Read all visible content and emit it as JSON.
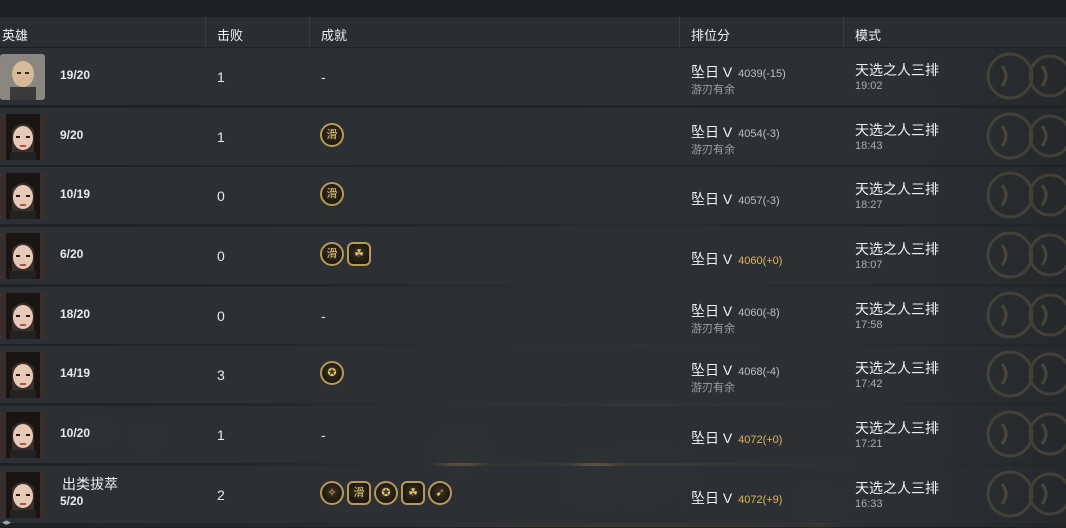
{
  "header": {
    "hero": "英雄",
    "kills": "击败",
    "achievements": "成就",
    "rank": "排位分",
    "mode": "模式"
  },
  "rows": [
    {
      "score": "19/20",
      "title": "",
      "kills": "1",
      "achievements": "-",
      "rank": "坠日 V",
      "points": "4039(-15)",
      "points_color": "grey",
      "rank_note": "游刃有余",
      "mode": "天选之人三排",
      "time": "19:02",
      "avatar": "bald-hero-avatar",
      "medals": []
    },
    {
      "score": "9/20",
      "title": "",
      "kills": "1",
      "achievements": "",
      "rank": "坠日 V",
      "points": "4054(-3)",
      "points_color": "grey",
      "rank_note": "游刃有余",
      "mode": "天选之人三排",
      "time": "18:43",
      "avatar": "female-hero-avatar",
      "medals": [
        "滑"
      ]
    },
    {
      "score": "10/19",
      "title": "",
      "kills": "0",
      "achievements": "",
      "rank": "坠日 V",
      "points": "4057(-3)",
      "points_color": "grey",
      "rank_note": "",
      "mode": "天选之人三排",
      "time": "18:27",
      "avatar": "female-hero-avatar",
      "medals": [
        "滑"
      ]
    },
    {
      "score": "6/20",
      "title": "",
      "kills": "0",
      "achievements": "",
      "rank": "坠日 V",
      "points": "4060(+0)",
      "points_color": "gold",
      "rank_note": "",
      "mode": "天选之人三排",
      "time": "18:07",
      "avatar": "female-hero-avatar",
      "medals": [
        "滑",
        "☘"
      ]
    },
    {
      "score": "18/20",
      "title": "",
      "kills": "0",
      "achievements": "-",
      "rank": "坠日 V",
      "points": "4060(-8)",
      "points_color": "grey",
      "rank_note": "游刃有余",
      "mode": "天选之人三排",
      "time": "17:58",
      "avatar": "female-hero-avatar",
      "medals": []
    },
    {
      "score": "14/19",
      "title": "",
      "kills": "3",
      "achievements": "",
      "rank": "坠日 V",
      "points": "4068(-4)",
      "points_color": "grey",
      "rank_note": "游刃有余",
      "mode": "天选之人三排",
      "time": "17:42",
      "avatar": "female-hero-avatar",
      "medals": [
        "✪"
      ]
    },
    {
      "score": "10/20",
      "title": "",
      "kills": "1",
      "achievements": "-",
      "rank": "坠日 V",
      "points": "4072(+0)",
      "points_color": "gold",
      "rank_note": "",
      "mode": "天选之人三排",
      "time": "17:21",
      "avatar": "female-hero-avatar",
      "medals": []
    },
    {
      "score": "5/20",
      "title": "出类拔萃",
      "kills": "2",
      "achievements": "",
      "rank": "坠日 V",
      "points": "4072(+9)",
      "points_color": "gold",
      "rank_note": "",
      "mode": "天选之人三排",
      "time": "16:33",
      "avatar": "female-hero-avatar",
      "medals": [
        "✧",
        "滑",
        "✪",
        "☘",
        "➹"
      ]
    }
  ],
  "colors": {
    "gold_points": "#e0b45a",
    "medal_border": "#b89a55",
    "row_bg": "#2c3034",
    "header_bg": "#2a2d31"
  }
}
